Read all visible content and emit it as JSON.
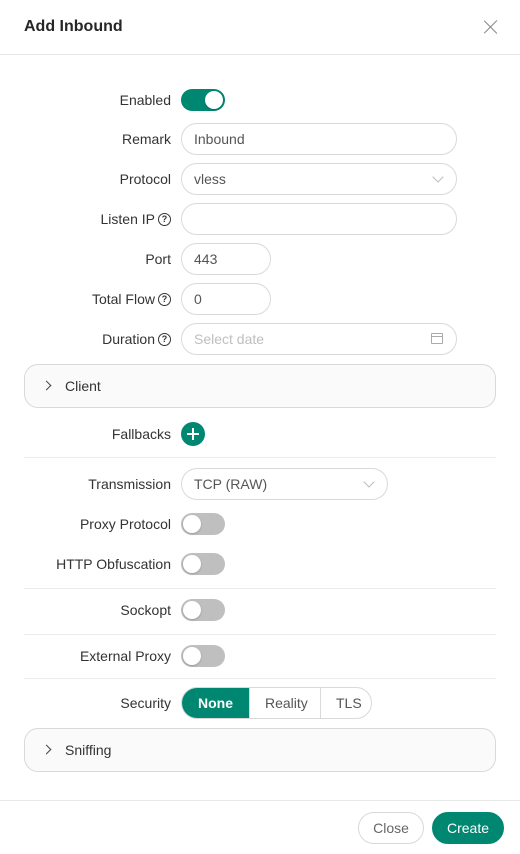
{
  "dialog": {
    "title": "Add Inbound"
  },
  "form": {
    "enabled": {
      "label": "Enabled",
      "value": true
    },
    "remark": {
      "label": "Remark",
      "value": "Inbound"
    },
    "protocol": {
      "label": "Protocol",
      "value": "vless"
    },
    "listen_ip": {
      "label": "Listen IP",
      "value": ""
    },
    "port": {
      "label": "Port",
      "value": "443"
    },
    "total_flow": {
      "label": "Total Flow",
      "value": "0"
    },
    "duration": {
      "label": "Duration",
      "placeholder": "Select date"
    },
    "client_panel": {
      "label": "Client"
    },
    "fallbacks": {
      "label": "Fallbacks"
    },
    "transmission": {
      "label": "Transmission",
      "value": "TCP (RAW)"
    },
    "proxy_protocol": {
      "label": "Proxy Protocol",
      "value": false
    },
    "http_obfuscation": {
      "label": "HTTP Obfuscation",
      "value": false
    },
    "sockopt": {
      "label": "Sockopt",
      "value": false
    },
    "external_proxy": {
      "label": "External Proxy",
      "value": false
    },
    "security": {
      "label": "Security",
      "options": [
        "None",
        "Reality",
        "TLS"
      ],
      "selected": "None"
    },
    "sniffing_panel": {
      "label": "Sniffing"
    }
  },
  "footer": {
    "close_label": "Close",
    "create_label": "Create"
  },
  "help_glyph": "?",
  "colors": {
    "accent": "#008771",
    "toggle_off": "#bfbfbf"
  }
}
